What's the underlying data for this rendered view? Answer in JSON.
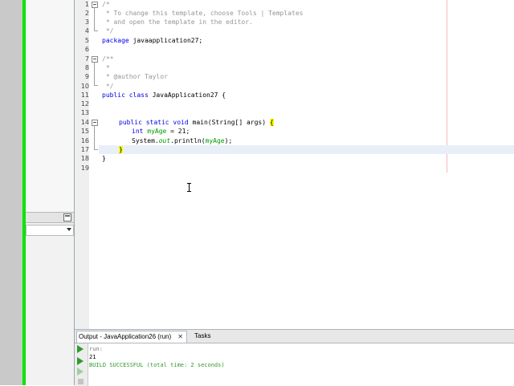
{
  "editor": {
    "lines": [
      {
        "num": "1"
      },
      {
        "num": "2"
      },
      {
        "num": "3"
      },
      {
        "num": "4"
      },
      {
        "num": "5"
      },
      {
        "num": "6"
      },
      {
        "num": "7"
      },
      {
        "num": "8"
      },
      {
        "num": "9"
      },
      {
        "num": "10"
      },
      {
        "num": "11"
      },
      {
        "num": "12"
      },
      {
        "num": "13"
      },
      {
        "num": "14"
      },
      {
        "num": "15"
      },
      {
        "num": "16"
      },
      {
        "num": "17"
      },
      {
        "num": "18"
      },
      {
        "num": "19"
      }
    ],
    "code": {
      "l1": "/*",
      "l2": " * To change this template, choose Tools | Templates",
      "l3": " * and open the template in the editor.",
      "l4": " */",
      "l5_kw": "package",
      "l5_rest": " javaapplication27;",
      "l7": "/**",
      "l8": " *",
      "l9": " * @author Taylor",
      "l10": " */",
      "l11_kw": "public class",
      "l11_rest": " JavaApplication27 {",
      "l14_kw": "public static void",
      "l14_rest": " main(String[] args) ",
      "l14_brace": "{",
      "l15_kw": "int",
      "l15_var": " myAge",
      "l15_rest": " = 21;",
      "l16_a": "System.",
      "l16_fld": "out",
      "l16_b": ".println(",
      "l16_var": "myAge",
      "l16_c": ");",
      "l17": "}",
      "l18": "}"
    }
  },
  "output": {
    "tab_label": "Output - JavaApplication26 (run)",
    "tab_close": "✕",
    "tasks_label": "Tasks",
    "lines": [
      "run:",
      "21",
      "BUILD SUCCESSFUL (total time: 2 seconds)"
    ]
  },
  "colors": {
    "keyword": "#0000e6",
    "comment": "#969696",
    "variable": "#009900",
    "success": "#2f9a2f",
    "green_bar": "#00e600"
  },
  "icons": [
    "run-icon",
    "rerun-icon",
    "stop-icon",
    "fold-icon",
    "minimize-icon",
    "dropdown-icon",
    "text-cursor-icon"
  ]
}
